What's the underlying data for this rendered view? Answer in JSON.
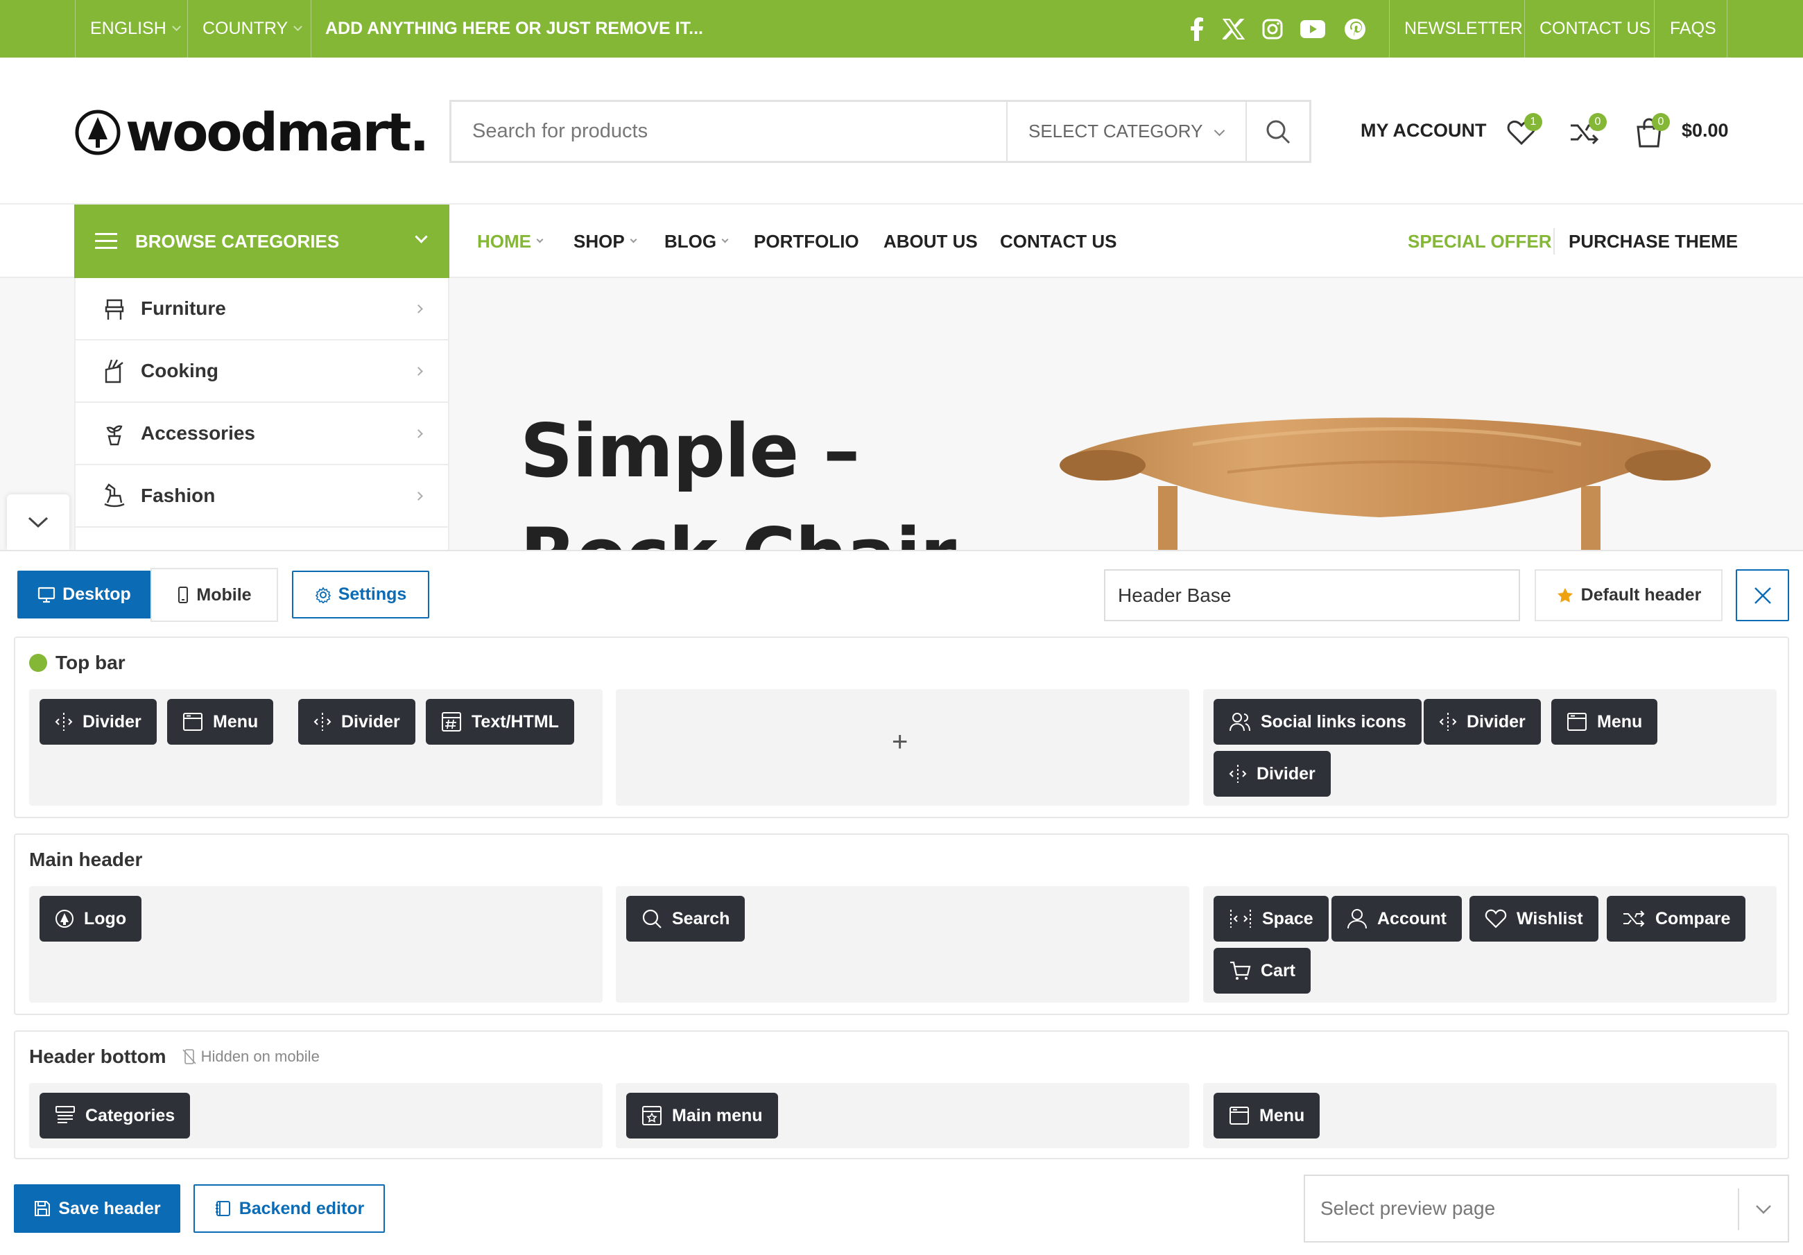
{
  "topbar": {
    "language": "ENGLISH",
    "country": "COUNTRY",
    "promo": "ADD ANYTHING HERE OR JUST REMOVE IT...",
    "links": [
      "NEWSLETTER",
      "CONTACT US",
      "FAQS"
    ],
    "social_icons": [
      "facebook-icon",
      "x-icon",
      "instagram-icon",
      "youtube-icon",
      "pinterest-icon"
    ]
  },
  "header": {
    "logo_text": "woodmart.",
    "search_placeholder": "Search for products",
    "category_select": "SELECT CATEGORY",
    "my_account": "MY ACCOUNT",
    "wishlist_count": "1",
    "compare_count": "0",
    "cart_count": "0",
    "cart_total": "$0.00"
  },
  "nav": {
    "browse_label": "BROWSE CATEGORIES",
    "items": [
      "HOME",
      "SHOP",
      "BLOG",
      "PORTFOLIO",
      "ABOUT US",
      "CONTACT US"
    ],
    "special_offer": "SPECIAL OFFER",
    "purchase_theme": "PURCHASE THEME"
  },
  "categories": [
    "Furniture",
    "Cooking",
    "Accessories",
    "Fashion"
  ],
  "hero": {
    "title_line1": "Simple –",
    "title_line2": "Rock Chair"
  },
  "builder": {
    "desktop": "Desktop",
    "mobile": "Mobile",
    "settings": "Settings",
    "header_name": "Header Base",
    "default_header": "Default header",
    "top_bar": {
      "title": "Top bar",
      "left": [
        "Divider",
        "Menu",
        "Divider",
        "Text/HTML"
      ],
      "right": [
        "Social links icons",
        "Divider",
        "Menu",
        "Divider"
      ]
    },
    "main_header": {
      "title": "Main header",
      "left": [
        "Logo"
      ],
      "center": [
        "Search"
      ],
      "right": [
        "Space",
        "Account",
        "Wishlist",
        "Compare",
        "Cart"
      ]
    },
    "header_bottom": {
      "title": "Header bottom",
      "hidden_note": "Hidden on mobile",
      "left": [
        "Categories"
      ],
      "center": [
        "Main menu"
      ],
      "right": [
        "Menu"
      ]
    },
    "save_header": "Save header",
    "backend_editor": "Backend editor",
    "preview_placeholder": "Select preview page"
  },
  "colors": {
    "brand_green": "#83b735",
    "primary_blue": "#0c6bb5",
    "chip_dark": "#2e3238"
  }
}
